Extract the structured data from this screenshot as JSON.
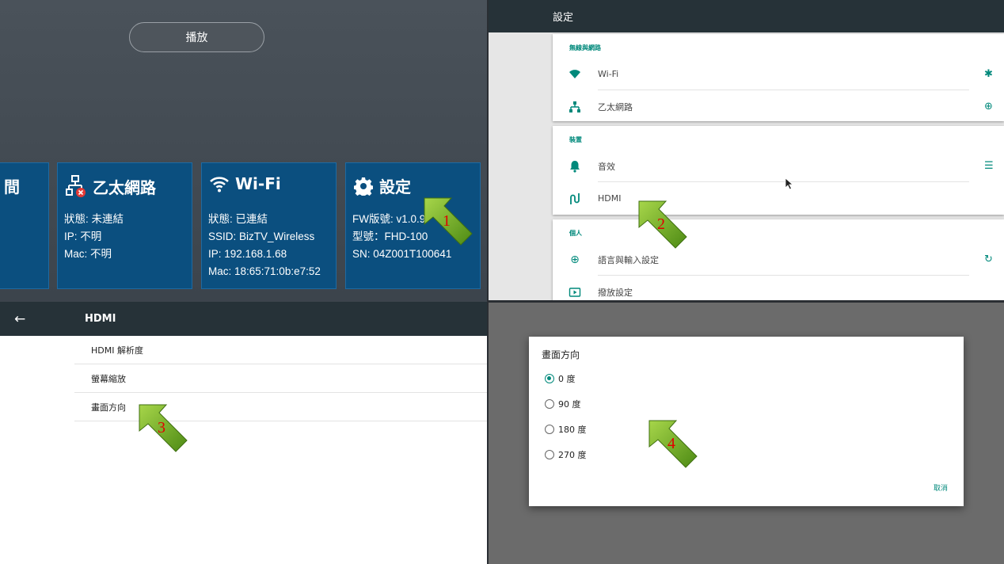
{
  "q1": {
    "play_button": "播放",
    "tiles": {
      "partial_label": "間",
      "ethernet": {
        "title": "乙太網路",
        "status": "狀態: 未連結",
        "ip": "IP: 不明",
        "mac": "Mac: 不明"
      },
      "wifi": {
        "title": "Wi-Fi",
        "status": "狀態: 已連結",
        "ssid": "SSID: BizTV_Wireless",
        "ip": "IP: 192.168.1.68",
        "mac": "Mac: 18:65:71:0b:e7:52"
      },
      "settings": {
        "title": "設定",
        "fw": "FW版號: v1.0.9r",
        "model": "型號：FHD-100",
        "sn": "SN: 04Z001T100641"
      }
    }
  },
  "q2": {
    "title": "設定",
    "sections": {
      "network": {
        "header": "無線與網路",
        "wifi": "Wi-Fi",
        "ethernet": "乙太網路"
      },
      "device": {
        "header": "裝置",
        "sound": "音效",
        "hdmi": "HDMI"
      },
      "personal": {
        "header": "個人",
        "language": "語言與輸入設定",
        "playback": "撥放設定"
      }
    }
  },
  "q3": {
    "title": "HDMI",
    "items": [
      "HDMI 解析度",
      "螢幕縮放",
      "畫面方向"
    ]
  },
  "q4": {
    "dialog_title": "畫面方向",
    "options": [
      "0 度",
      "90 度",
      "180 度",
      "270 度"
    ],
    "selected": "0 度",
    "cancel": "取消"
  },
  "annotations": [
    "1",
    "2",
    "3",
    "4"
  ],
  "colors": {
    "tile": "#0b4f7f",
    "accent": "#00897b",
    "toolbar": "#263238",
    "arrow": "#6aa321",
    "number": "#e00000"
  },
  "icons": [
    "ethernet-disconnected-icon",
    "wifi-icon",
    "gear-icon",
    "wifi-signal-icon",
    "bluetooth-icon",
    "network-icon",
    "globe-icon",
    "bell-icon",
    "list-icon",
    "hdmi-icon",
    "language-icon",
    "timer-icon",
    "play-icon",
    "back-arrow-icon"
  ]
}
